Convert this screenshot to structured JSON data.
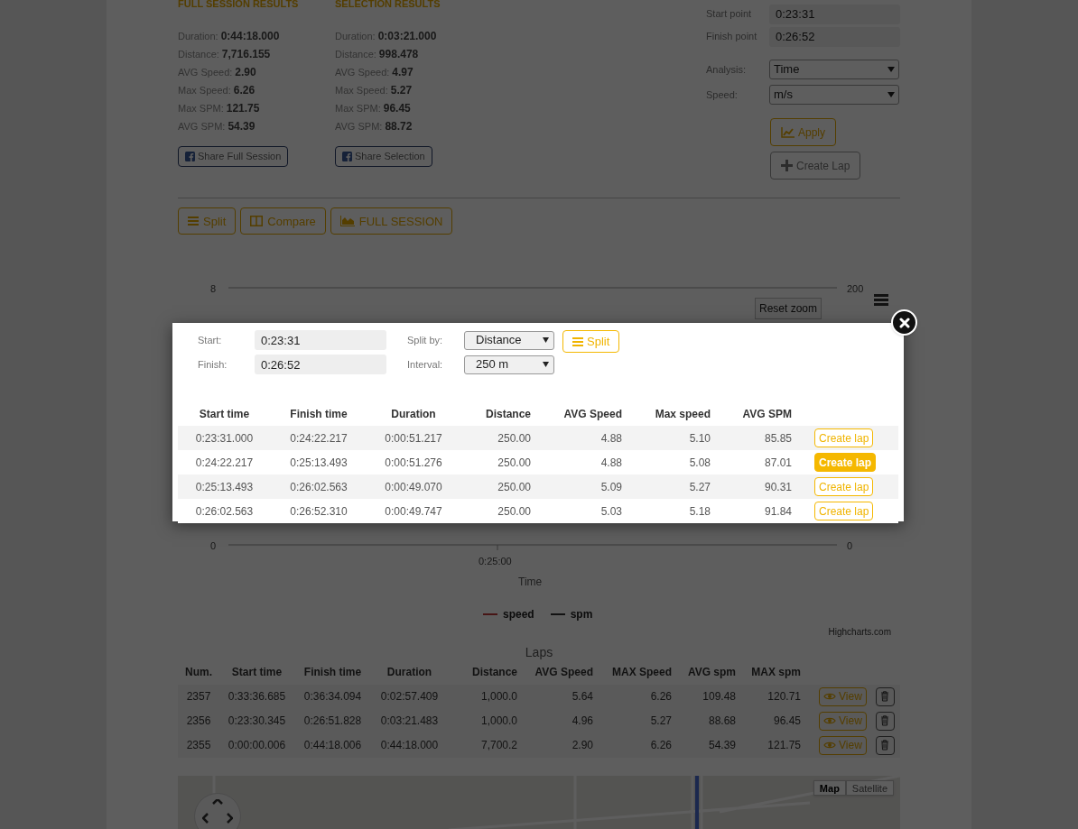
{
  "full_session": {
    "title": "FULL SESSION RESULTS",
    "stats": [
      {
        "label": "Duration:",
        "value": "0:44:18.000"
      },
      {
        "label": "Distance:",
        "value": "7,716.155"
      },
      {
        "label": "AVG Speed:",
        "value": "2.90"
      },
      {
        "label": "Max Speed:",
        "value": "6.26"
      },
      {
        "label": "Max SPM:",
        "value": "121.75"
      },
      {
        "label": "AVG SPM:",
        "value": "54.39"
      }
    ],
    "share_button": "Share Full Session"
  },
  "selection": {
    "title": "SELECTION RESULTS",
    "stats": [
      {
        "label": "Duration:",
        "value": "0:03:21.000"
      },
      {
        "label": "Distance:",
        "value": "998.478"
      },
      {
        "label": "AVG Speed:",
        "value": "4.97"
      },
      {
        "label": "Max Speed:",
        "value": "5.27"
      },
      {
        "label": "Max SPM:",
        "value": "96.45"
      },
      {
        "label": "AVG SPM:",
        "value": "88.72"
      }
    ],
    "share_button": "Share Selection"
  },
  "range_form": {
    "fields": [
      {
        "label": "Start point",
        "value": "0:23:31"
      },
      {
        "label": "Finish point",
        "value": "0:26:52"
      }
    ],
    "selects": [
      {
        "label": "Analysis:",
        "value": "Time"
      },
      {
        "label": "Speed:",
        "value": "m/s"
      }
    ],
    "buttons": [
      {
        "kind": "apply",
        "label": "Apply"
      },
      {
        "kind": "create",
        "label": "Create Lap"
      }
    ]
  },
  "view_buttons": [
    {
      "kind": "split",
      "label": "Split"
    },
    {
      "kind": "compare",
      "label": "Compare"
    },
    {
      "kind": "full",
      "label": "FULL SESSION"
    }
  ],
  "chart": {
    "y_left_ticks": [
      "8",
      "0"
    ],
    "y_right_ticks": [
      "200",
      "0"
    ],
    "x_ticks": [
      "0:25:00"
    ],
    "x_title": "Time",
    "legend": [
      {
        "name": "speed",
        "kind": "accent"
      },
      {
        "name": "spm",
        "kind": "plain"
      }
    ],
    "reset_zoom": "Reset zoom",
    "credits": "Highcharts.com"
  },
  "laps": {
    "title": "Laps",
    "columns": [
      "Num.",
      "Start time",
      "Finish time",
      "Duration",
      "Distance",
      "AVG Speed",
      "MAX Speed",
      "AVG spm",
      "MAX spm"
    ],
    "rows": [
      {
        "cells": [
          "2357",
          "0:33:36.685",
          "0:36:34.094",
          "0:02:57.409",
          "1,000.0",
          "5.64",
          "6.26",
          "109.48",
          "120.71"
        ],
        "view_button": "View"
      },
      {
        "cells": [
          "2356",
          "0:23:30.345",
          "0:26:51.828",
          "0:03:21.483",
          "1,000.0",
          "4.96",
          "5.27",
          "88.68",
          "96.45"
        ],
        "view_button": "View"
      },
      {
        "cells": [
          "2355",
          "0:00:00.006",
          "0:44:18.006",
          "0:44:18.000",
          "7,700.2",
          "2.90",
          "6.26",
          "54.39",
          "121.75"
        ],
        "view_button": "View"
      }
    ]
  },
  "map": {
    "types": [
      {
        "label": "Map",
        "selected": true
      },
      {
        "label": "Satellite",
        "selected": false
      }
    ]
  },
  "split_dialog": {
    "fields": [
      {
        "label": "Start:",
        "value": "0:23:31"
      },
      {
        "label": "Finish:",
        "value": "0:26:52"
      }
    ],
    "selects": [
      {
        "label": "Split by:",
        "value": "Distance"
      },
      {
        "label": "Interval:",
        "value": "250 m"
      }
    ],
    "split_button": "Split",
    "columns": [
      "Start time",
      "Finish time",
      "Duration",
      "Distance",
      "AVG Speed",
      "Max speed",
      "AVG SPM"
    ],
    "rows": [
      {
        "cells": [
          "0:23:31.000",
          "0:24:22.217",
          "0:00:51.217",
          "250.00",
          "4.88",
          "5.10",
          "85.85"
        ],
        "button": "Create lap",
        "highlighted": false
      },
      {
        "cells": [
          "0:24:22.217",
          "0:25:13.493",
          "0:00:51.276",
          "250.00",
          "4.88",
          "5.08",
          "87.01"
        ],
        "button": "Create lap",
        "highlighted": true
      },
      {
        "cells": [
          "0:25:13.493",
          "0:26:02.563",
          "0:00:49.070",
          "250.00",
          "5.09",
          "5.27",
          "90.31"
        ],
        "button": "Create lap",
        "highlighted": false
      },
      {
        "cells": [
          "0:26:02.563",
          "0:26:52.310",
          "0:00:49.747",
          "250.00",
          "5.03",
          "5.18",
          "91.84"
        ],
        "button": "Create lap",
        "highlighted": false
      }
    ]
  }
}
